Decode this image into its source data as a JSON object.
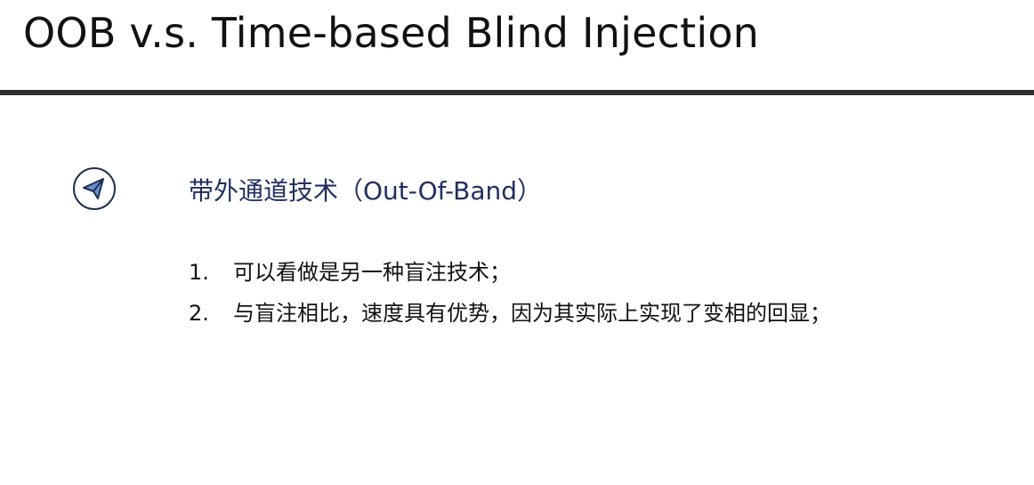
{
  "title": "OOB v.s. Time-based Blind Injection",
  "section": {
    "icon": "paper-plane-icon",
    "heading": "带外通道技术（Out-Of-Band）"
  },
  "points": [
    {
      "num": "1.",
      "text": "可以看做是另一种盲注技术；"
    },
    {
      "num": "2.",
      "text": "与盲注相比，速度具有优势，因为其实际上实现了变相的回显；"
    }
  ],
  "colors": {
    "heading": "#1f2f5f",
    "rule": "#2f2f2f",
    "icon_fill": "#6a8fd0"
  }
}
